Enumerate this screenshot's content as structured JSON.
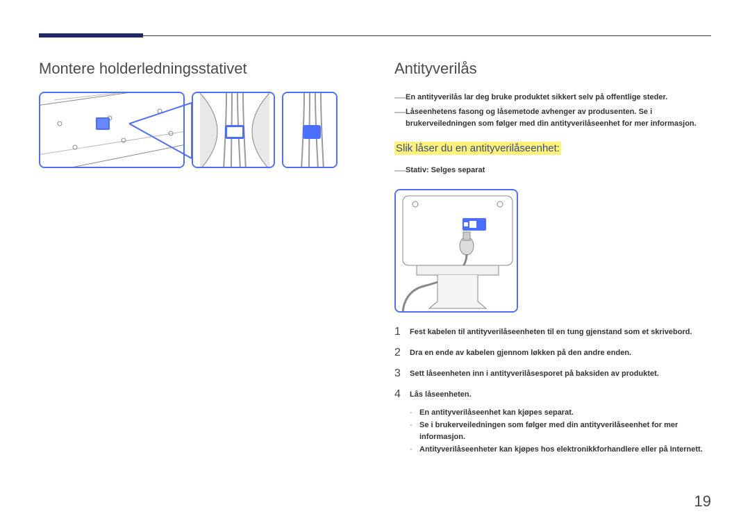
{
  "left": {
    "heading": "Montere holderledningsstativet"
  },
  "right": {
    "heading": "Antityverilås",
    "notes": [
      "En antityverilås lar deg bruke produktet sikkert selv på offentlige steder.",
      "Låseenhetens fasong og låsemetode avhenger av produsenten. Se i brukerveiledningen som følger med din antityverilåseenhet for mer informasjon."
    ],
    "sub_heading": "Slik låser du en antityverilåseenhet:",
    "stand_note": "Stativ: Selges separat",
    "steps": [
      "Fest kabelen til antityverilåseenheten til en tung gjenstand som et skrivebord.",
      "Dra en ende av kabelen gjennom løkken på den andre enden.",
      "Sett låseenheten inn i antityverilåsesporet på baksiden av produktet.",
      "Lås låseenheten."
    ],
    "sub_notes": [
      "En antityverilåseenhet kan kjøpes separat.",
      "Se i brukerveiledningen som følger med din antityverilåseenhet for mer informasjon.",
      "Antityverilåseenheter kan kjøpes hos elektronikkforhandlere eller på Internett."
    ]
  },
  "page_number": "19"
}
